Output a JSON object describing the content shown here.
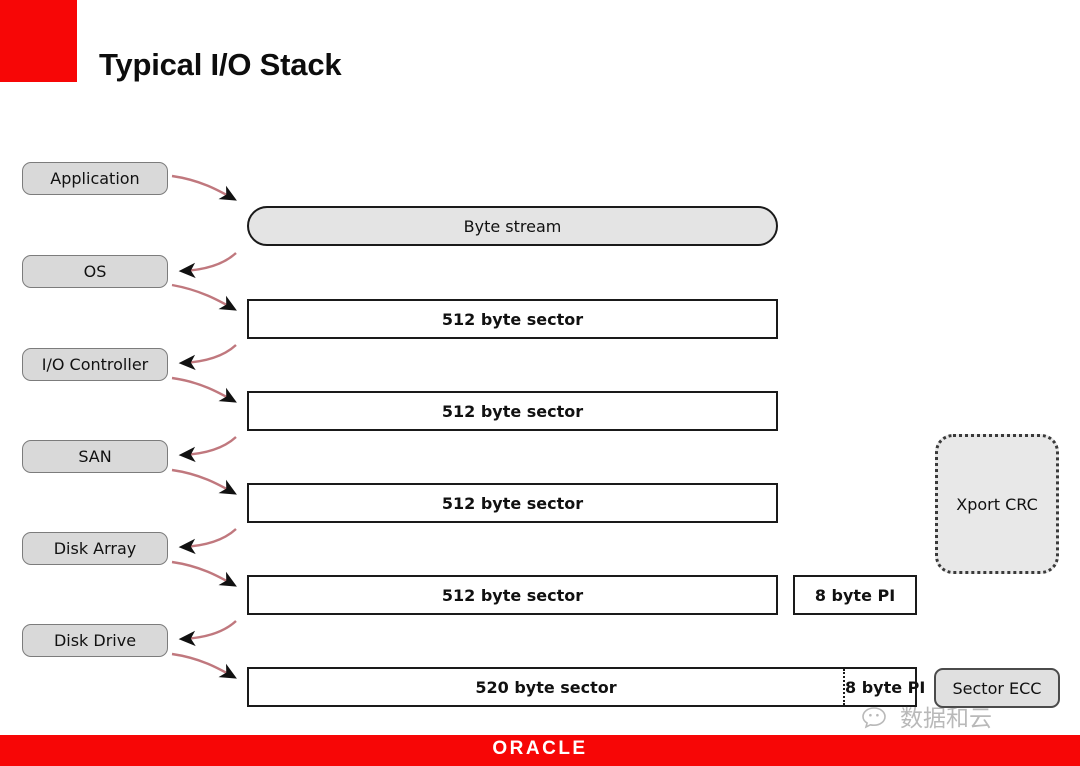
{
  "slide": {
    "title": "Typical I/O Stack",
    "accent_red": "#f70606",
    "box_gray": "#d9d9d9"
  },
  "stages": [
    {
      "label": "Application",
      "name": "stage-application"
    },
    {
      "label": "OS",
      "name": "stage-os"
    },
    {
      "label": "I/O Controller",
      "name": "stage-io-controller"
    },
    {
      "label": "SAN",
      "name": "stage-san"
    },
    {
      "label": "Disk Array",
      "name": "stage-disk-array"
    },
    {
      "label": "Disk Drive",
      "name": "stage-disk-drive"
    }
  ],
  "rows": [
    {
      "main": "Byte stream",
      "pi": null
    },
    {
      "main": "512 byte sector",
      "pi": null
    },
    {
      "main": "512 byte sector",
      "pi": null
    },
    {
      "main": "512 byte sector",
      "pi": null
    },
    {
      "main": "512 byte sector",
      "pi": "8 byte PI"
    },
    {
      "main": "520 byte sector",
      "pi": "8 byte PI"
    }
  ],
  "annotations": {
    "xport_crc": "Xport CRC",
    "sector_ecc": "Sector ECC"
  },
  "footer": {
    "logo": "ORACLE",
    "watermark_text": "数据和云",
    "watermark_icon": "wechat-icon"
  }
}
